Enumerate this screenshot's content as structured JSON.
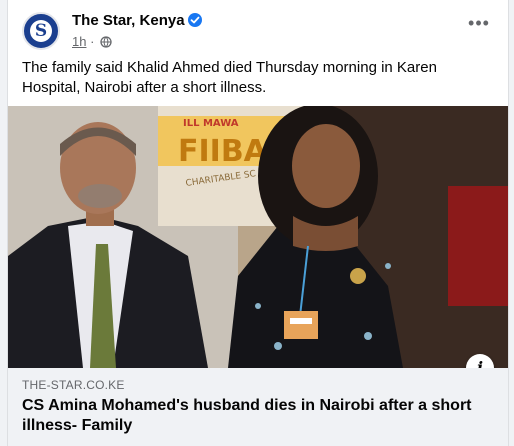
{
  "post": {
    "page_name": "The Star, Kenya",
    "avatar_letter": "S",
    "time": "1h",
    "separator": "·",
    "more_label": "•••",
    "caption": "The family said Khalid Ahmed died Thursday morning in Karen Hospital, Nairobi after a short illness."
  },
  "image": {
    "banner_text_top": "ILL MAWA",
    "banner_text_mid": "FIIBA",
    "banner_text_low": "CHARITABLE SC",
    "info_label": "i"
  },
  "link": {
    "domain": "THE-STAR.CO.KE",
    "title": "CS Amina Mohamed's husband dies in Nairobi after a short illness- Family"
  },
  "colors": {
    "brand": "#1b3f8f",
    "verified": "#1877f2"
  }
}
